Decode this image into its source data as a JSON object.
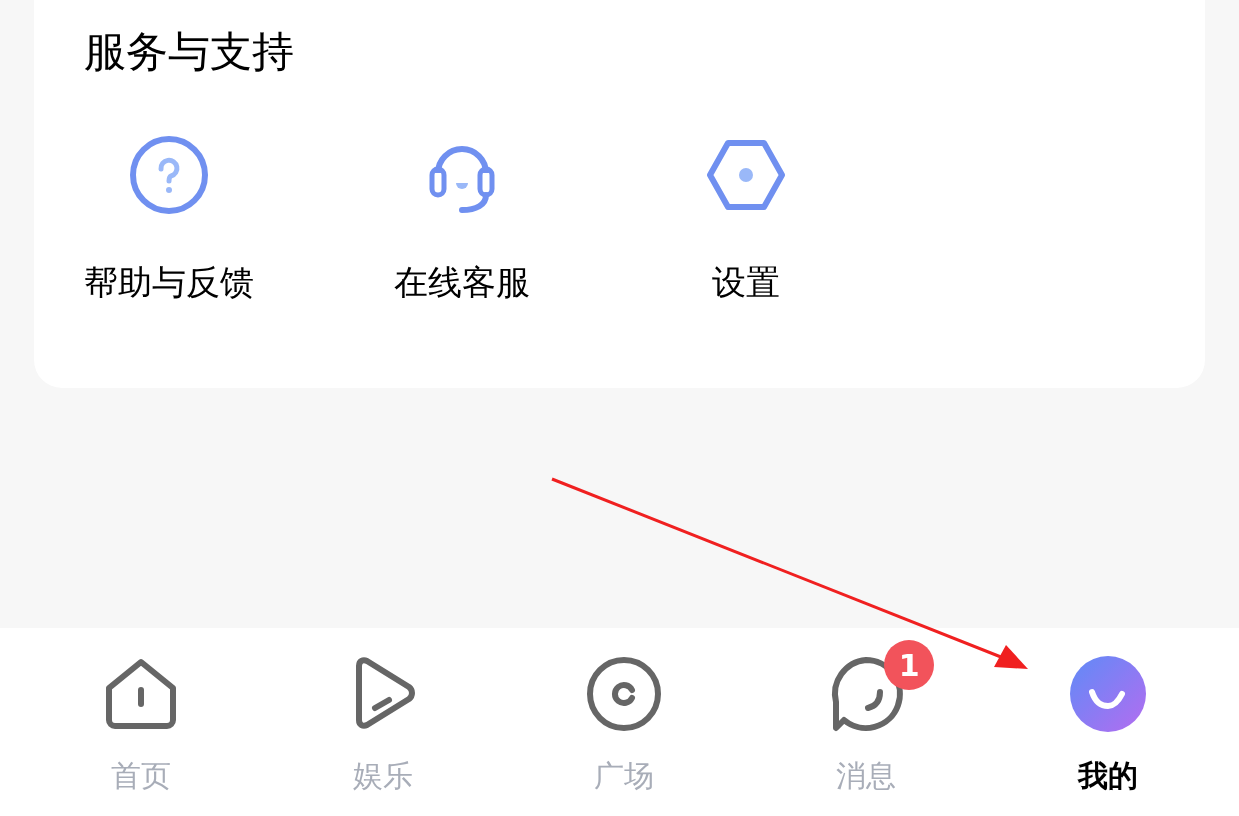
{
  "section": {
    "title": "服务与支持",
    "items": [
      {
        "kind": "help",
        "label": "帮助与反馈"
      },
      {
        "kind": "service",
        "label": "在线客服"
      },
      {
        "kind": "settings",
        "label": "设置"
      }
    ]
  },
  "tab_bar": {
    "tabs": [
      {
        "kind": "home",
        "label": "首页",
        "selected": false
      },
      {
        "kind": "play",
        "label": "娱乐",
        "selected": false
      },
      {
        "kind": "plaza",
        "label": "广场",
        "selected": false
      },
      {
        "kind": "message",
        "label": "消息",
        "selected": false,
        "badge": "1"
      },
      {
        "kind": "profile",
        "label": "我的",
        "selected": true
      }
    ]
  }
}
